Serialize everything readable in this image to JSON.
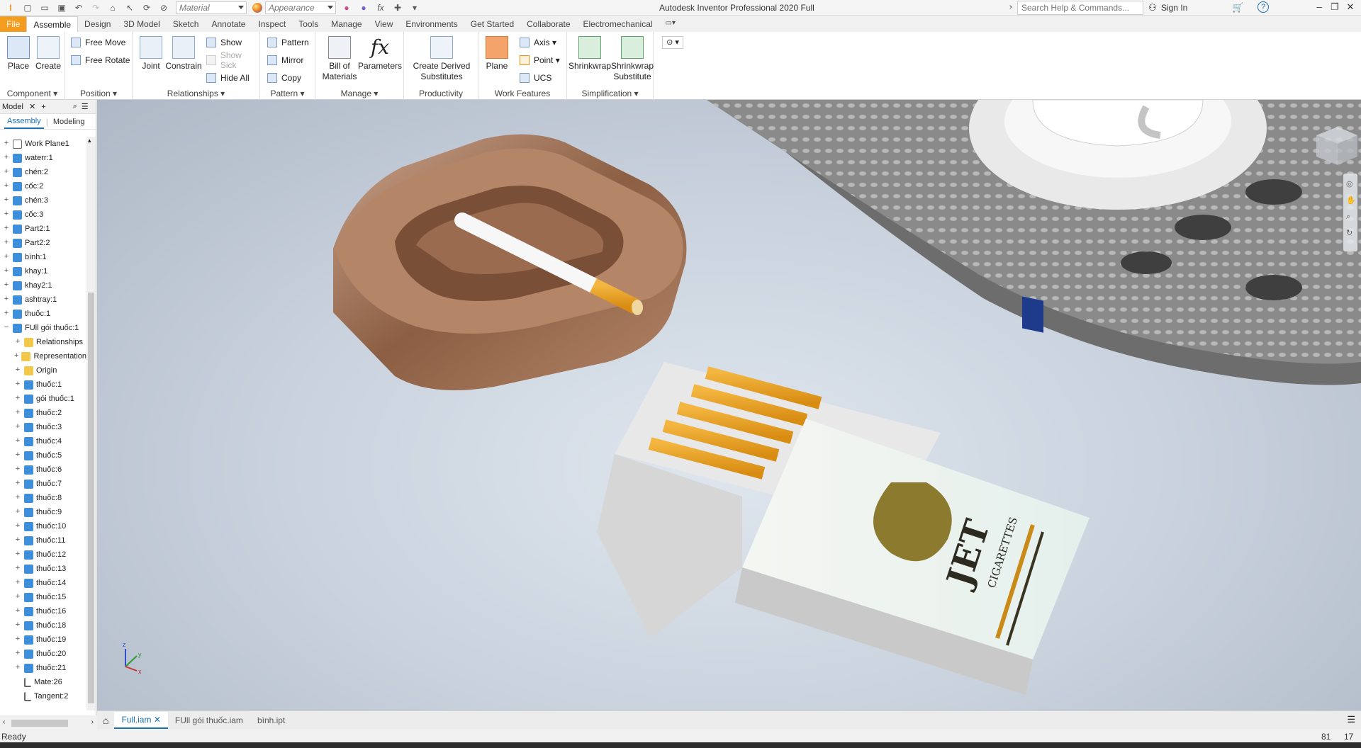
{
  "titlebar": {
    "app_title": "Autodesk Inventor Professional 2020   Full",
    "material_placeholder": "Material",
    "appearance_placeholder": "Appearance",
    "search_placeholder": "Search Help & Commands...",
    "sign_in": "Sign In"
  },
  "tabs": [
    "File",
    "Assemble",
    "Design",
    "3D Model",
    "Sketch",
    "Annotate",
    "Inspect",
    "Tools",
    "Manage",
    "View",
    "Environments",
    "Get Started",
    "Collaborate",
    "Electromechanical"
  ],
  "ribbon": {
    "component": {
      "title": "Component",
      "place": "Place",
      "create": "Create"
    },
    "position": {
      "title": "Position",
      "free_move": "Free Move",
      "free_rotate": "Free Rotate"
    },
    "relationships": {
      "title": "Relationships",
      "joint": "Joint",
      "constrain": "Constrain",
      "show": "Show",
      "show_sick": "Show Sick",
      "hide_all": "Hide All"
    },
    "pattern": {
      "title": "Pattern",
      "pattern": "Pattern",
      "mirror": "Mirror",
      "copy": "Copy"
    },
    "manage": {
      "title": "Manage",
      "bom_line1": "Bill of",
      "bom_line2": "Materials",
      "parameters": "Parameters"
    },
    "productivity": {
      "title": "Productivity",
      "cds_line1": "Create Derived",
      "cds_line2": "Substitutes"
    },
    "work_features": {
      "title": "Work Features",
      "plane": "Plane",
      "axis": "Axis",
      "point": "Point",
      "ucs": "UCS"
    },
    "simplification": {
      "title": "Simplification",
      "shrinkwrap": "Shrinkwrap",
      "sws_line1": "Shrinkwrap",
      "sws_line2": "Substitute"
    }
  },
  "browser": {
    "header": "Model",
    "tab_assembly": "Assembly",
    "tab_modeling": "Modeling",
    "items": [
      {
        "label": "Work Plane1",
        "level": 0,
        "icon": "plane",
        "exp": "+"
      },
      {
        "label": "waterr:1",
        "level": 0,
        "icon": "part",
        "exp": "+"
      },
      {
        "label": "chén:2",
        "level": 0,
        "icon": "part",
        "exp": "+"
      },
      {
        "label": "cốc:2",
        "level": 0,
        "icon": "part",
        "exp": "+"
      },
      {
        "label": "chén:3",
        "level": 0,
        "icon": "part",
        "exp": "+"
      },
      {
        "label": "cốc:3",
        "level": 0,
        "icon": "part",
        "exp": "+"
      },
      {
        "label": "Part2:1",
        "level": 0,
        "icon": "part",
        "exp": "+"
      },
      {
        "label": "Part2:2",
        "level": 0,
        "icon": "part",
        "exp": "+"
      },
      {
        "label": "bình:1",
        "level": 0,
        "icon": "part",
        "exp": "+"
      },
      {
        "label": "khay:1",
        "level": 0,
        "icon": "part",
        "exp": "+"
      },
      {
        "label": "khay2:1",
        "level": 0,
        "icon": "part",
        "exp": "+"
      },
      {
        "label": "ashtray:1",
        "level": 0,
        "icon": "part",
        "exp": "+"
      },
      {
        "label": "thuốc:1",
        "level": 0,
        "icon": "part",
        "exp": "+"
      },
      {
        "label": "FUll gói thuốc:1",
        "level": 0,
        "icon": "part",
        "exp": "−"
      },
      {
        "label": "Relationships",
        "level": 1,
        "icon": "folder",
        "exp": "+"
      },
      {
        "label": "Representations",
        "level": 1,
        "icon": "folder",
        "exp": "+"
      },
      {
        "label": "Origin",
        "level": 1,
        "icon": "folder",
        "exp": "+"
      },
      {
        "label": "thuốc:1",
        "level": 1,
        "icon": "part",
        "exp": "+"
      },
      {
        "label": "gói thuốc:1",
        "level": 1,
        "icon": "part",
        "exp": "+"
      },
      {
        "label": "thuốc:2",
        "level": 1,
        "icon": "part",
        "exp": "+"
      },
      {
        "label": "thuốc:3",
        "level": 1,
        "icon": "part",
        "exp": "+"
      },
      {
        "label": "thuốc:4",
        "level": 1,
        "icon": "part",
        "exp": "+"
      },
      {
        "label": "thuốc:5",
        "level": 1,
        "icon": "part",
        "exp": "+"
      },
      {
        "label": "thuốc:6",
        "level": 1,
        "icon": "part",
        "exp": "+"
      },
      {
        "label": "thuốc:7",
        "level": 1,
        "icon": "part",
        "exp": "+"
      },
      {
        "label": "thuốc:8",
        "level": 1,
        "icon": "part",
        "exp": "+"
      },
      {
        "label": "thuốc:9",
        "level": 1,
        "icon": "part",
        "exp": "+"
      },
      {
        "label": "thuốc:10",
        "level": 1,
        "icon": "part",
        "exp": "+"
      },
      {
        "label": "thuốc:11",
        "level": 1,
        "icon": "part",
        "exp": "+"
      },
      {
        "label": "thuốc:12",
        "level": 1,
        "icon": "part",
        "exp": "+"
      },
      {
        "label": "thuốc:13",
        "level": 1,
        "icon": "part",
        "exp": "+"
      },
      {
        "label": "thuốc:14",
        "level": 1,
        "icon": "part",
        "exp": "+"
      },
      {
        "label": "thuốc:15",
        "level": 1,
        "icon": "part",
        "exp": "+"
      },
      {
        "label": "thuốc:16",
        "level": 1,
        "icon": "part",
        "exp": "+"
      },
      {
        "label": "thuốc:18",
        "level": 1,
        "icon": "part",
        "exp": "+"
      },
      {
        "label": "thuốc:19",
        "level": 1,
        "icon": "part",
        "exp": "+"
      },
      {
        "label": "thuốc:20",
        "level": 1,
        "icon": "part",
        "exp": "+"
      },
      {
        "label": "thuốc:21",
        "level": 1,
        "icon": "part",
        "exp": "+"
      },
      {
        "label": "Mate:26",
        "level": 1,
        "icon": "mate",
        "exp": ""
      },
      {
        "label": "Tangent:2",
        "level": 1,
        "icon": "mate",
        "exp": ""
      }
    ]
  },
  "viewport": {
    "pack_brand": "JET",
    "pack_sub": "CIGARETTES",
    "axis_x": "x",
    "axis_y": "y",
    "axis_z": "z"
  },
  "doc_tabs": [
    "Full.iam",
    "FUll gói thuốc.iam",
    "bình.ipt"
  ],
  "status": {
    "text": "Ready",
    "num1": "81",
    "num2": "17"
  },
  "colors": {
    "file_tab": "#f39c20",
    "accent": "#1b6fb3"
  }
}
